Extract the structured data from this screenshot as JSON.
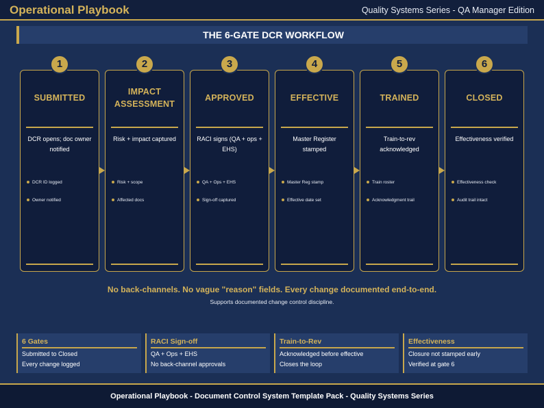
{
  "header": {
    "brand": "Operational Playbook",
    "edition": "Quality Systems Series - QA Manager Edition"
  },
  "banner": {
    "title": "THE 6-GATE DCR WORKFLOW"
  },
  "gates": [
    {
      "number": "1",
      "title": "SUBMITTED",
      "description": "DCR opens; doc owner notified",
      "bullets": [
        "DCR ID logged",
        "Owner notified"
      ]
    },
    {
      "number": "2",
      "title": "IMPACT ASSESSMENT",
      "description": "Risk + impact captured",
      "bullets": [
        "Risk + scope",
        "Affected docs"
      ]
    },
    {
      "number": "3",
      "title": "APPROVED",
      "description": "RACI signs (QA + ops + EHS)",
      "bullets": [
        "QA + Ops + EHS",
        "Sign-off captured"
      ]
    },
    {
      "number": "4",
      "title": "EFFECTIVE",
      "description": "Master Register stamped",
      "bullets": [
        "Master Reg stamp",
        "Effective date set"
      ]
    },
    {
      "number": "5",
      "title": "TRAINED",
      "description": "Train-to-rev acknowledged",
      "bullets": [
        "Train roster",
        "Acknowledgment trail"
      ]
    },
    {
      "number": "6",
      "title": "CLOSED",
      "description": "Effectiveness verified",
      "bullets": [
        "Effectiveness check",
        "Audit trail intact"
      ]
    }
  ],
  "tagline": "No back-channels.  No vague \"reason\" fields.  Every change documented end-to-end.",
  "subline": "Supports documented change control discipline.",
  "panels": [
    {
      "title": "6 Gates",
      "lines": [
        "Submitted to Closed",
        "Every change logged"
      ]
    },
    {
      "title": "RACI Sign-off",
      "lines": [
        "QA + Ops + EHS",
        "No back-channel approvals"
      ]
    },
    {
      "title": "Train-to-Rev",
      "lines": [
        "Acknowledged before effective",
        "Closes the loop"
      ]
    },
    {
      "title": "Effectiveness",
      "lines": [
        "Closure not stamped early",
        "Verified at gate 6"
      ]
    }
  ],
  "footer": "Operational Playbook  -  Document Control System Template Pack  -  Quality Systems Series",
  "colors": {
    "background": "#1b2f55",
    "gold": "#c9a84c",
    "card": "#101d3b",
    "panel": "#263e6b"
  }
}
